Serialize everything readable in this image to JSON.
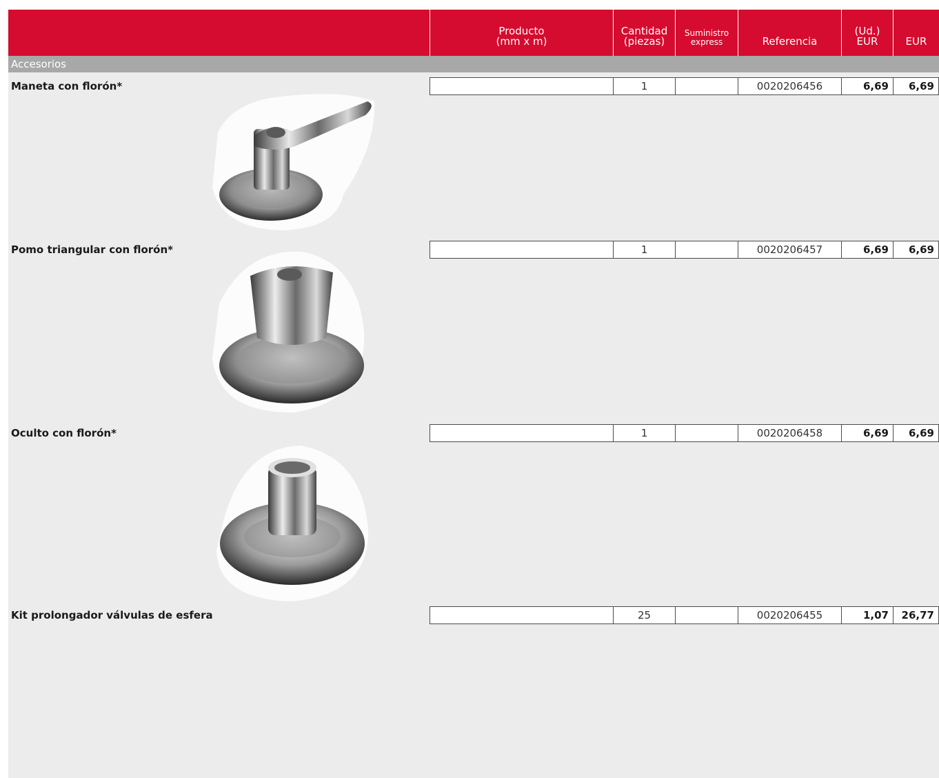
{
  "header": {
    "producto": "Producto\n(mm x m)",
    "cantidad": "Cantidad\n(piezas)",
    "suministro": "Suministro\nexpress",
    "referencia": "Referencia",
    "unit_price": "(Ud.)\nEUR",
    "eur": "EUR"
  },
  "section": "Accesorios",
  "products": [
    {
      "name": "Maneta con florón*",
      "producto": "",
      "cantidad": "1",
      "suministro": "",
      "referencia": "0020206456",
      "unit_price": "6,69",
      "total": "6,69",
      "image": "lever-handle-with-rosette"
    },
    {
      "name": "Pomo triangular con florón*",
      "producto": "",
      "cantidad": "1",
      "suministro": "",
      "referencia": "0020206457",
      "unit_price": "6,69",
      "total": "6,69",
      "image": "triangular-knob-with-rosette"
    },
    {
      "name": "Oculto con florón*",
      "producto": "",
      "cantidad": "1",
      "suministro": "",
      "referencia": "0020206458",
      "unit_price": "6,69",
      "total": "6,69",
      "image": "concealed-stem-with-rosette"
    },
    {
      "name": "Kit prolongador válvulas de esfera",
      "producto": "",
      "cantidad": "25",
      "suministro": "",
      "referencia": "0020206455",
      "unit_price": "1,07",
      "total": "26,77"
    }
  ],
  "colors": {
    "header": "#d50c2f",
    "section": "#a8a8a8",
    "background": "#ececec"
  }
}
